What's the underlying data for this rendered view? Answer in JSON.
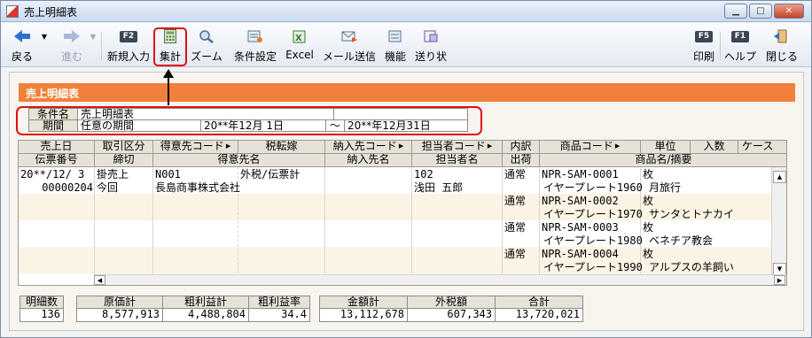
{
  "window": {
    "title": "売上明細表"
  },
  "toolbar": {
    "items": [
      {
        "label": "戻る",
        "icon": "back-arrow-icon",
        "enabled": true
      },
      {
        "label": "進む",
        "icon": "forward-arrow-icon",
        "enabled": false
      },
      {
        "label": "新規入力",
        "key": "F2",
        "icon": "f2-key-icon",
        "enabled": true
      },
      {
        "label": "集計",
        "icon": "calculator-icon",
        "enabled": true
      },
      {
        "label": "ズーム",
        "icon": "zoom-icon",
        "enabled": true
      },
      {
        "label": "条件設定",
        "icon": "settings-icon",
        "enabled": true
      },
      {
        "label": "Excel",
        "icon": "excel-icon",
        "enabled": true
      },
      {
        "label": "メール送信",
        "icon": "mail-icon",
        "enabled": true
      },
      {
        "label": "機能",
        "icon": "function-icon",
        "enabled": true
      },
      {
        "label": "送り状",
        "icon": "invoice-icon",
        "enabled": true
      },
      {
        "label": "印刷",
        "key": "F5",
        "icon": "f5-key-icon",
        "enabled": true
      },
      {
        "label": "ヘルプ",
        "key": "F1",
        "icon": "f1-key-icon",
        "enabled": true
      },
      {
        "label": "閉じる",
        "icon": "close-door-icon",
        "enabled": true
      }
    ]
  },
  "section_title": "売上明細表",
  "conditions": {
    "name_label": "条件名",
    "name_value": "売上明細表",
    "period_label": "期間",
    "period_type": "任意の期間",
    "period_from": "20**年12月 1日",
    "period_sep": "～",
    "period_to": "20**年12月31日"
  },
  "grid": {
    "header_row1": [
      "売上日",
      "取引区分",
      "得意先コード",
      "税転嫁",
      "納入先コード",
      "担当者コード",
      "内訳",
      "商品コード",
      "単位",
      "入数",
      "ケース"
    ],
    "header_row2": [
      "伝票番号",
      "締切",
      "得意先名",
      "納入先名",
      "担当者名",
      "出荷",
      "商品名/摘要"
    ],
    "left": {
      "date": "20**/12/ 3",
      "slip_no": "00000204",
      "trade_type": "掛売上",
      "closing": "今回",
      "customer_code": "N001",
      "tax": "外税/伝票計",
      "customer_name": "長島商事株式会社",
      "staff_code": "102",
      "staff_name": "浅田 五郎"
    },
    "items": [
      {
        "breakdown": "通常",
        "code": "NPR-SAM-0001",
        "unit": "枚",
        "name": "イヤープレート1960 月旅行"
      },
      {
        "breakdown": "通常",
        "code": "NPR-SAM-0002",
        "unit": "枚",
        "name": "イヤープレート1970 サンタとトナカイ"
      },
      {
        "breakdown": "通常",
        "code": "NPR-SAM-0003",
        "unit": "枚",
        "name": "イヤープレート1980 ベネチア教会"
      },
      {
        "breakdown": "通常",
        "code": "NPR-SAM-0004",
        "unit": "枚",
        "name": "イヤープレート1990 アルプスの羊飼い"
      }
    ]
  },
  "totals": {
    "count_label": "明細数",
    "count": "136",
    "cost_label": "原価計",
    "cost": "8,577,913",
    "profit_label": "粗利益計",
    "profit": "4,488,804",
    "rate_label": "粗利益率",
    "rate": "34.4",
    "amount_label": "金額計",
    "amount": "13,112,678",
    "tax_label": "外税額",
    "tax": "607,343",
    "total_label": "合計",
    "total": "13,720,021"
  },
  "colors": {
    "section_bar": "#f0803c",
    "highlight": "#e01010",
    "header_bg": "#e7e2d8"
  }
}
